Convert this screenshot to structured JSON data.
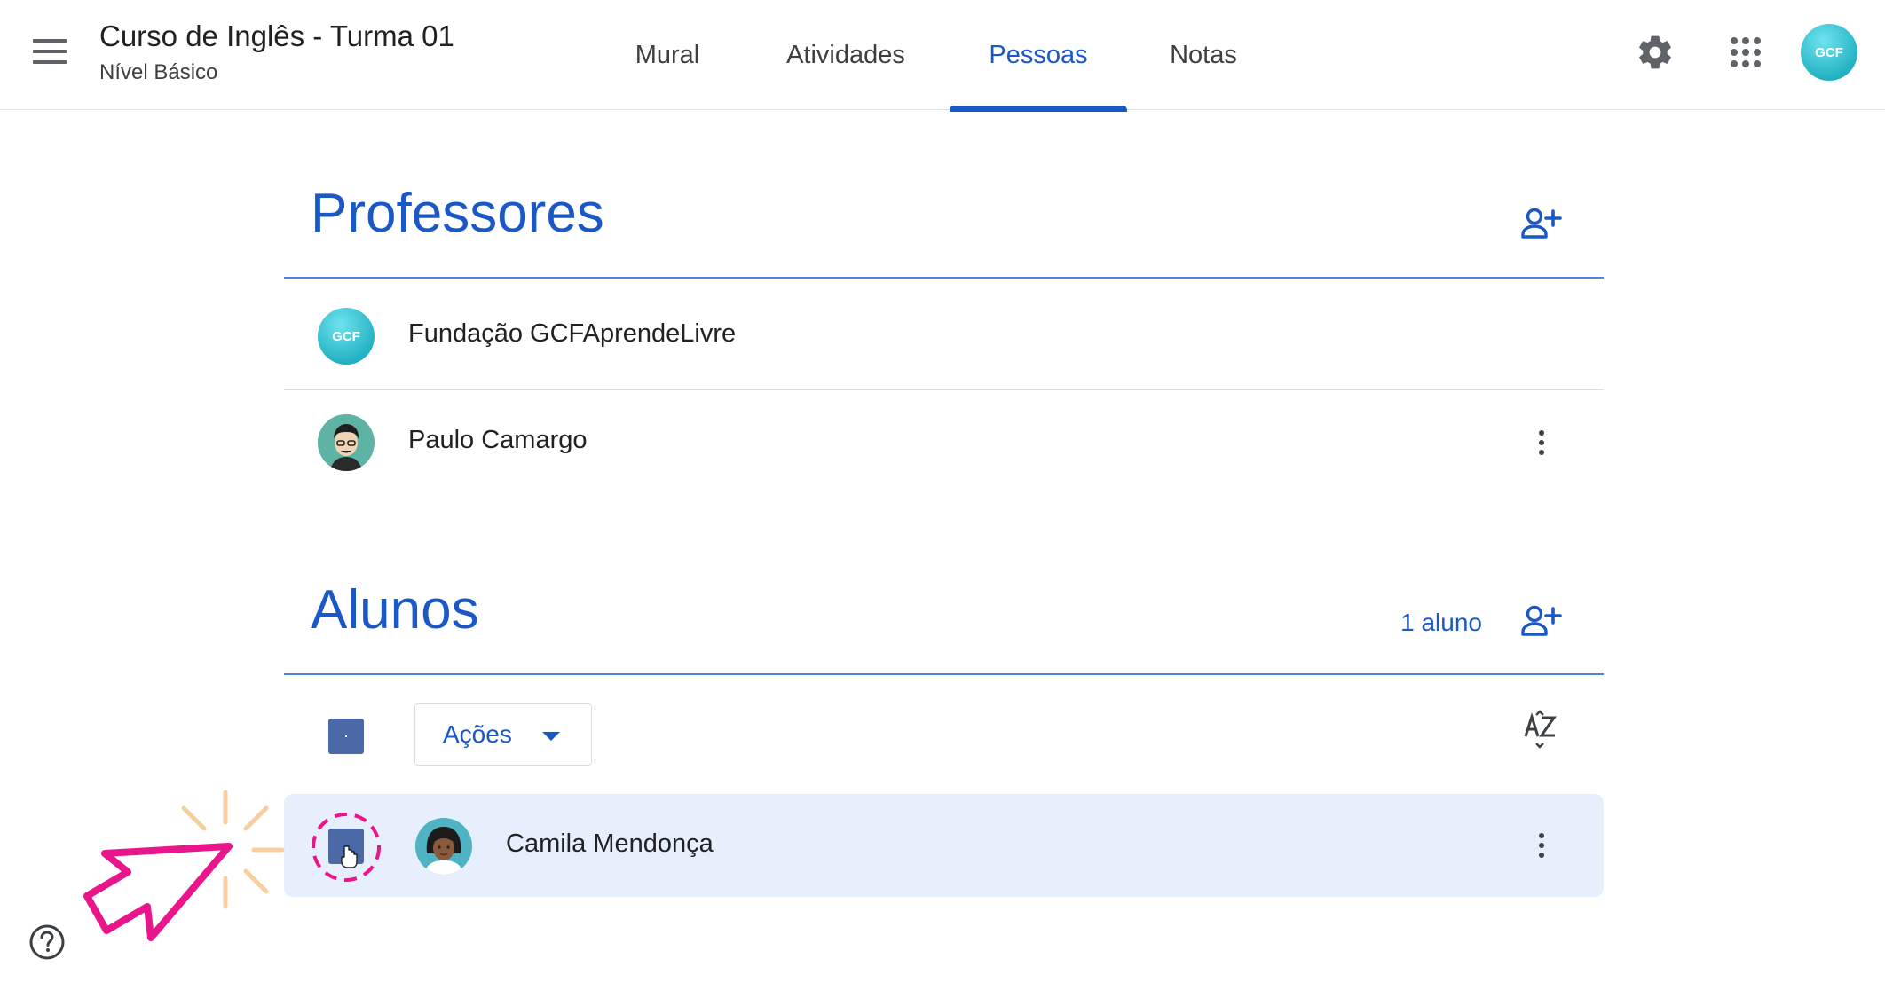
{
  "header": {
    "title": "Curso de Inglês - Turma 01",
    "subtitle": "Nível Básico",
    "tabs": [
      {
        "label": "Mural",
        "active": false
      },
      {
        "label": "Atividades",
        "active": false
      },
      {
        "label": "Pessoas",
        "active": true
      },
      {
        "label": "Notas",
        "active": false
      }
    ],
    "icons": [
      "menu-icon",
      "settings-icon",
      "apps-grid-icon"
    ],
    "account_avatar_text": "GCF"
  },
  "teachers": {
    "title": "Professores",
    "add_icon": "person-add-icon",
    "people": [
      {
        "name": "Fundação GCFAprendeLivre",
        "avatar_text": "GCF"
      },
      {
        "name": "Paulo Camargo"
      }
    ]
  },
  "students": {
    "title": "Alunos",
    "count": "1 aluno",
    "add_icon": "person-add-icon",
    "actions_label": "Ações",
    "sort_icon": "sort-az-icon",
    "people": [
      {
        "name": "Camila Mendonça",
        "selected": true
      }
    ]
  },
  "colors": {
    "accent": "#1a57c7",
    "checkbox": "#4a69a6",
    "selected_row": "#e7effd",
    "pointer_annotation": "#e8168a",
    "sparkle": "#f7cf9c"
  }
}
